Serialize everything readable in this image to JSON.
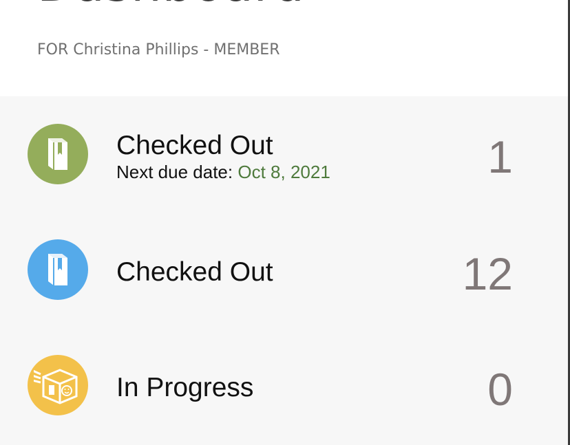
{
  "header": {
    "title": "Dashboard",
    "subtitle": "FOR Christina Phillips - MEMBER"
  },
  "items": [
    {
      "label": "Checked Out",
      "due_prefix": "Next due date:",
      "due_date": "Oct 8, 2021",
      "count": "1",
      "icon": "book-icon",
      "color": "#94ad5b"
    },
    {
      "label": "Checked Out",
      "count": "12",
      "icon": "book-icon",
      "color": "#55aaea"
    },
    {
      "label": "In Progress",
      "count": "0",
      "icon": "package-box-icon",
      "color": "#f3c14a"
    }
  ],
  "colors": {
    "due_date": "#4e7a3c",
    "count": "#7f7777",
    "panel_background": "#f7f7f7"
  }
}
